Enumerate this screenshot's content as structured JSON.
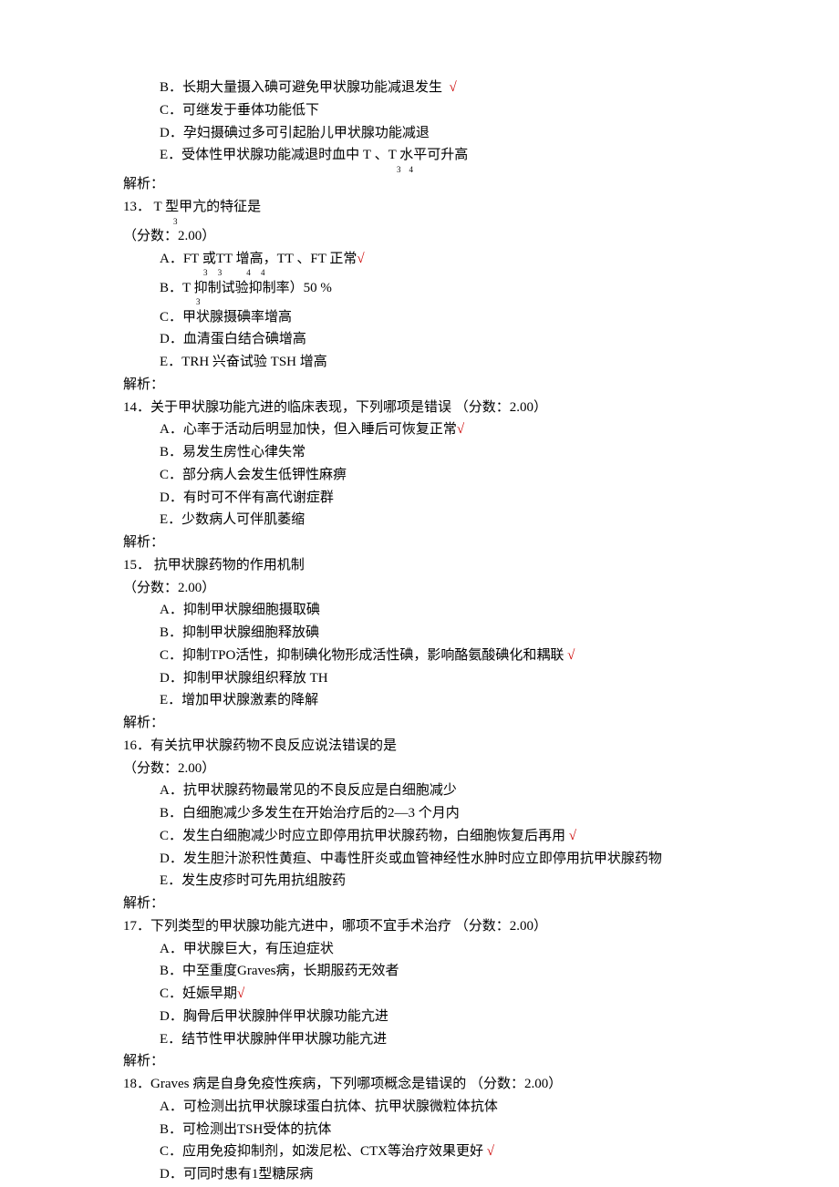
{
  "lines": {
    "q12": {
      "B": "B．长期大量摄入碘可避免甲状腺功能减退发生  ",
      "Bmark": "√",
      "C": "C．可继发于垂体功能低下",
      "D": "D．孕妇摄碘过多可引起胎儿甲状腺功能减退",
      "E_a": "E．受体性甲状腺功能减退时血中 T ",
      "E_b": "、T 水平可升高",
      "E_sub1": "3",
      "E_sub2": "4"
    },
    "jiexi": "解析：",
    "q13": {
      "title_a": "13． T ",
      "title_sub": "3",
      "title_b": "型甲亢的特征是",
      "score": "（分数：2.00）",
      "A_a": "A．FT 或TT 增高，TT 、FT 正常",
      "A_sub": "3  3          4      4",
      "Amark": "√",
      "B_a": "B．T ",
      "B_sub": "3",
      "B_b": "抑制试验抑制率）50 %",
      "C": "C．甲状腺摄碘率增高",
      "D": "D．血清蛋白结合碘增高",
      "E": "E．TRH 兴奋试验 TSH 增高"
    },
    "q14": {
      "title": "14．关于甲状腺功能亢进的临床表现，下列哪项是错误 （分数：2.00）",
      "A": "A．心率于活动后明显加快，但入睡后可恢复正常",
      "Amark": "√",
      "B": "B．易发生房性心律失常",
      "C": "C．部分病人会发生低钾性麻痹",
      "D": "D．有时可不伴有高代谢症群",
      "E": "E．少数病人可伴肌萎缩"
    },
    "q15": {
      "title": "15． 抗甲状腺药物的作用机制",
      "score": "（分数：2.00）",
      "A": "A．抑制甲状腺细胞摄取碘",
      "B": "B．抑制甲状腺细胞释放碘",
      "C": "C．抑制TPO活性，抑制碘化物形成活性碘，影响酪氨酸碘化和耦联 ",
      "Cmark": "√",
      "D": "D．抑制甲状腺组织释放 TH",
      "E": "E．增加甲状腺激素的降解"
    },
    "q16": {
      "title": "16．有关抗甲状腺药物不良反应说法错误的是",
      "score": "（分数：2.00）",
      "A": "A．抗甲状腺药物最常见的不良反应是白细胞减少",
      "B": "B．白细胞减少多发生在开始治疗后的2—3 个月内",
      "C": "C．发生白细胞减少时应立即停用抗甲状腺药物，白细胞恢复后再用 ",
      "Cmark": "√",
      "D": "D．发生胆汁淤积性黄疸、中毒性肝炎或血管神经性水肿时应立即停用抗甲状腺药物",
      "E": "E．发生皮疹时可先用抗组胺药"
    },
    "q17": {
      "title": "17．下列类型的甲状腺功能亢进中，哪项不宜手术治疗 （分数：2.00）",
      "A": "A．甲状腺巨大，有压迫症状",
      "B": "B．中至重度Graves病，长期服药无效者",
      "C": "C．妊娠早期",
      "Cmark": "√",
      "D": "D．胸骨后甲状腺肿伴甲状腺功能亢进",
      "E": "E．结节性甲状腺肿伴甲状腺功能亢进"
    },
    "q18": {
      "title": "18．Graves 病是自身免疫性疾病，下列哪项概念是错误的 （分数：2.00）",
      "A": "A．可检测出抗甲状腺球蛋白抗体、抗甲状腺微粒体抗体",
      "B": "B．可检测出TSH受体的抗体",
      "C": "C．应用免疫抑制剂，如泼尼松、CTX等治疗效果更好 ",
      "Cmark": "√",
      "D": "D．可同时患有1型糖尿病"
    }
  }
}
